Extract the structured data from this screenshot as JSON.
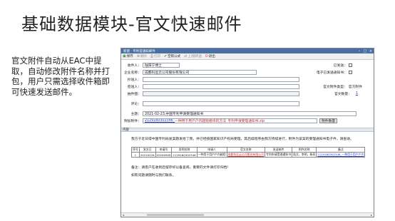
{
  "slide": {
    "title": "基础数据模块-官文快速邮件",
    "description": "官文附件自动从EAC中提取，自动修改附件名称并打包，用户只需选择收件箱即可快速发送邮件。"
  },
  "window": {
    "title": "新建 · 专利官通知邮件",
    "toolbar": [
      {
        "label": "保存",
        "icon": "save-icon",
        "state": "enabled"
      },
      {
        "label": "删除",
        "icon": "delete-icon",
        "state": "disabled"
      },
      {
        "label": "打印",
        "icon": "print-icon",
        "state": "disabled"
      },
      {
        "label": "空帮公式",
        "icon": "check-icon",
        "state": "enabled"
      },
      {
        "label": "上/翻转送",
        "icon": "forward-icon",
        "state": "disabled"
      },
      {
        "label": "退出",
        "icon": "exit-icon",
        "state": "enabled"
      }
    ]
  },
  "form": {
    "recipient": {
      "label": "收件人：",
      "value": "陆阳宁博士"
    },
    "company": {
      "label": "企业名称：",
      "value": "成都科远云公司股份有限公司"
    },
    "cc": {
      "label": "抄送人：",
      "value": ""
    },
    "bcc": {
      "label": "密送人：",
      "value": ""
    },
    "attachment_row": {
      "label": "抽件图：",
      "value": ""
    },
    "remark": {
      "label": "评论：",
      "value": ""
    },
    "subject": {
      "label": "主题：",
      "value": "2021-02-23,中国专利申请受理通知书"
    },
    "attachment": {
      "label": "附加附件：",
      "value_prefix": "2129160302346_",
      "value_link": "一种用于用户户内越程模块的方法_专利申请受理通知书.zip",
      "button_label": "附件数量"
    },
    "right": {
      "sent_label": "已发送：",
      "read_receipt_label": "电子已发送通知书：",
      "sender_label": "官文附件类型：",
      "sender_value": "官方附件",
      "count_label": "官文数量：",
      "count_value": "1"
    }
  },
  "body": {
    "header": "内容",
    "paragraph": "我方于近日得中国专利局发案题发给了我，并已经按国家知识产权局受理，其后续程序由我方持续进行，附件为该案的受理通知书电子件，请查收。",
    "table": {
      "headers": [
        "序号",
        "发文日",
        "申请号",
        "发明名称",
        "申请人",
        "官文名称",
        "发送邮件",
        "附件名称",
        "备注"
      ],
      "rows": [
        [
          "1",
          "20210226",
          "20200909",
          "2129160302346",
          "一种用于用户户内越程",
          "成都科远云公司股份有限公司",
          "专利申请受理通知书",
          "陆文，李明，杨亮",
          "2129160302346_一种用于用户户内"
        ]
      ]
    },
    "note": "备注：请客户在收到后留存好以备查阅，重要的文件请打印归档！",
    "note2": "如有问题请随时与我们联系。"
  }
}
